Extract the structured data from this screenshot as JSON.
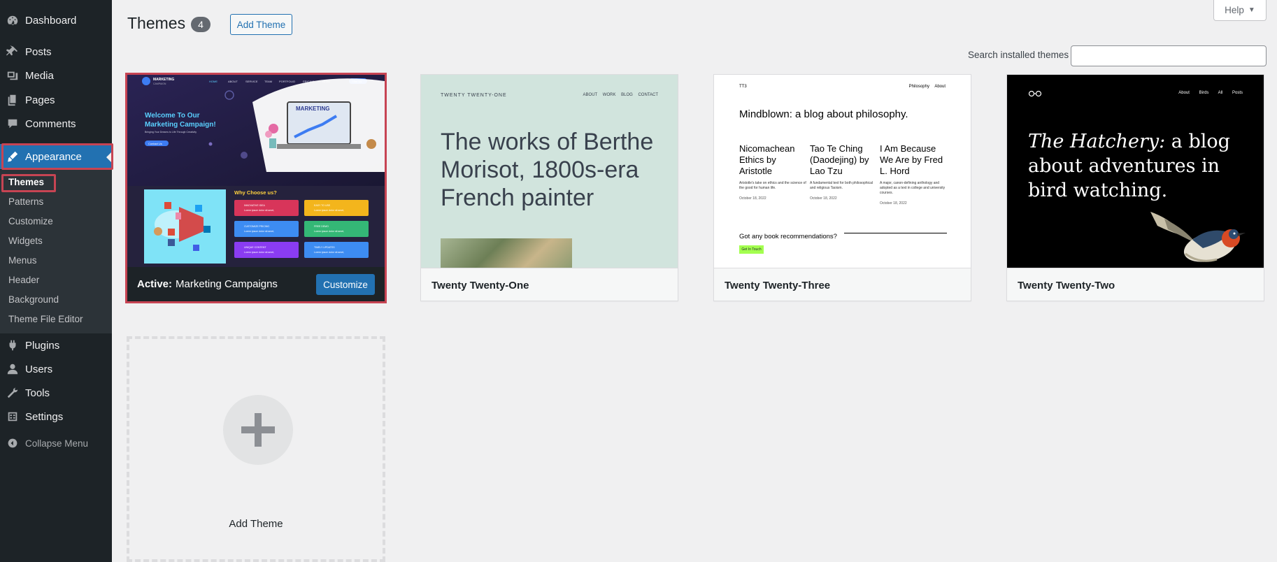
{
  "sidebar": {
    "items": [
      {
        "label": "Dashboard",
        "icon": "dashboard-icon"
      },
      {
        "label": "Posts",
        "icon": "pin-icon"
      },
      {
        "label": "Media",
        "icon": "media-icon"
      },
      {
        "label": "Pages",
        "icon": "pages-icon"
      },
      {
        "label": "Comments",
        "icon": "comment-icon"
      },
      {
        "label": "Appearance",
        "icon": "brush-icon"
      },
      {
        "label": "Plugins",
        "icon": "plug-icon"
      },
      {
        "label": "Users",
        "icon": "user-icon"
      },
      {
        "label": "Tools",
        "icon": "wrench-icon"
      },
      {
        "label": "Settings",
        "icon": "settings-icon"
      }
    ],
    "submenu": [
      "Themes",
      "Patterns",
      "Customize",
      "Widgets",
      "Menus",
      "Header",
      "Background",
      "Theme File Editor"
    ],
    "collapse_label": "Collapse Menu"
  },
  "header": {
    "title": "Themes",
    "count": "4",
    "add_button": "Add Theme",
    "help_label": "Help"
  },
  "search": {
    "label": "Search installed themes",
    "value": ""
  },
  "active_theme": {
    "prefix": "Active:",
    "name": "Marketing Campaigns",
    "customize_label": "Customize",
    "preview": {
      "brand": "MARKETING",
      "brand_sub": "CAMPAIGN",
      "nav": [
        "HOME",
        "ABOUT",
        "SERVICE",
        "TEAM",
        "PORTFOLIO",
        "PRICING",
        "BLOG"
      ],
      "nav_button": "Hire Us",
      "headline_1": "Welcome To Our",
      "headline_2": "Marketing Campaign!",
      "tagline": "Bringing Your Dreams to Life Through Creativity",
      "cta": "Contact Us",
      "laptop_text": "MARKETING",
      "why_title": "Why Choose us?",
      "features": [
        "INNOVATIVE IDEA",
        "EASY TO USE",
        "CUSTOMIZE PRICING",
        "FREE DEMO",
        "UNIQUE CONTENT",
        "TIMELY UPDATES"
      ],
      "feature_desc": "Lorem ipsum dolor sit amet,"
    }
  },
  "themes": [
    {
      "name": "Twenty Twenty-One",
      "preview": {
        "site": "TWENTY TWENTY-ONE",
        "nav": "ABOUT WORK BLOG CONTACT",
        "headline": "The works of Berthe Morisot, 1800s-era French painter"
      }
    },
    {
      "name": "Twenty Twenty-Three",
      "preview": {
        "logo": "TT3",
        "nav": "Philosophy About",
        "tagline": "Mindblown: a blog about philosophy.",
        "posts": [
          {
            "title": "Nicomachean Ethics by Aristotle",
            "excerpt": "Aristotle's take on ethics and the science of the good for human life.",
            "date": "October 18, 2022"
          },
          {
            "title": "Tao Te Ching (Daodejing) by Lao Tzu",
            "excerpt": "A fundamental text for both philosophical and religious Taoism.",
            "date": "October 18, 2022"
          },
          {
            "title": "I Am Because We Are by Fred L. Hord",
            "excerpt": "A major, canon-defining anthology and adopted as a text in college and university courses.",
            "date": "October 18, 2022"
          }
        ],
        "question": "Got any book recommendations?",
        "button": "Get In Touch"
      }
    },
    {
      "name": "Twenty Twenty-Two",
      "preview": {
        "nav": "About Birds All Posts",
        "headline_italic": "The Hatchery:",
        "headline_rest": " a blog about adventures in bird watching."
      }
    }
  ],
  "add_tile": {
    "label": "Add Theme"
  },
  "colors": {
    "sidebar_bg": "#1d2327",
    "accent": "#2271b1",
    "highlight": "#c74453"
  }
}
